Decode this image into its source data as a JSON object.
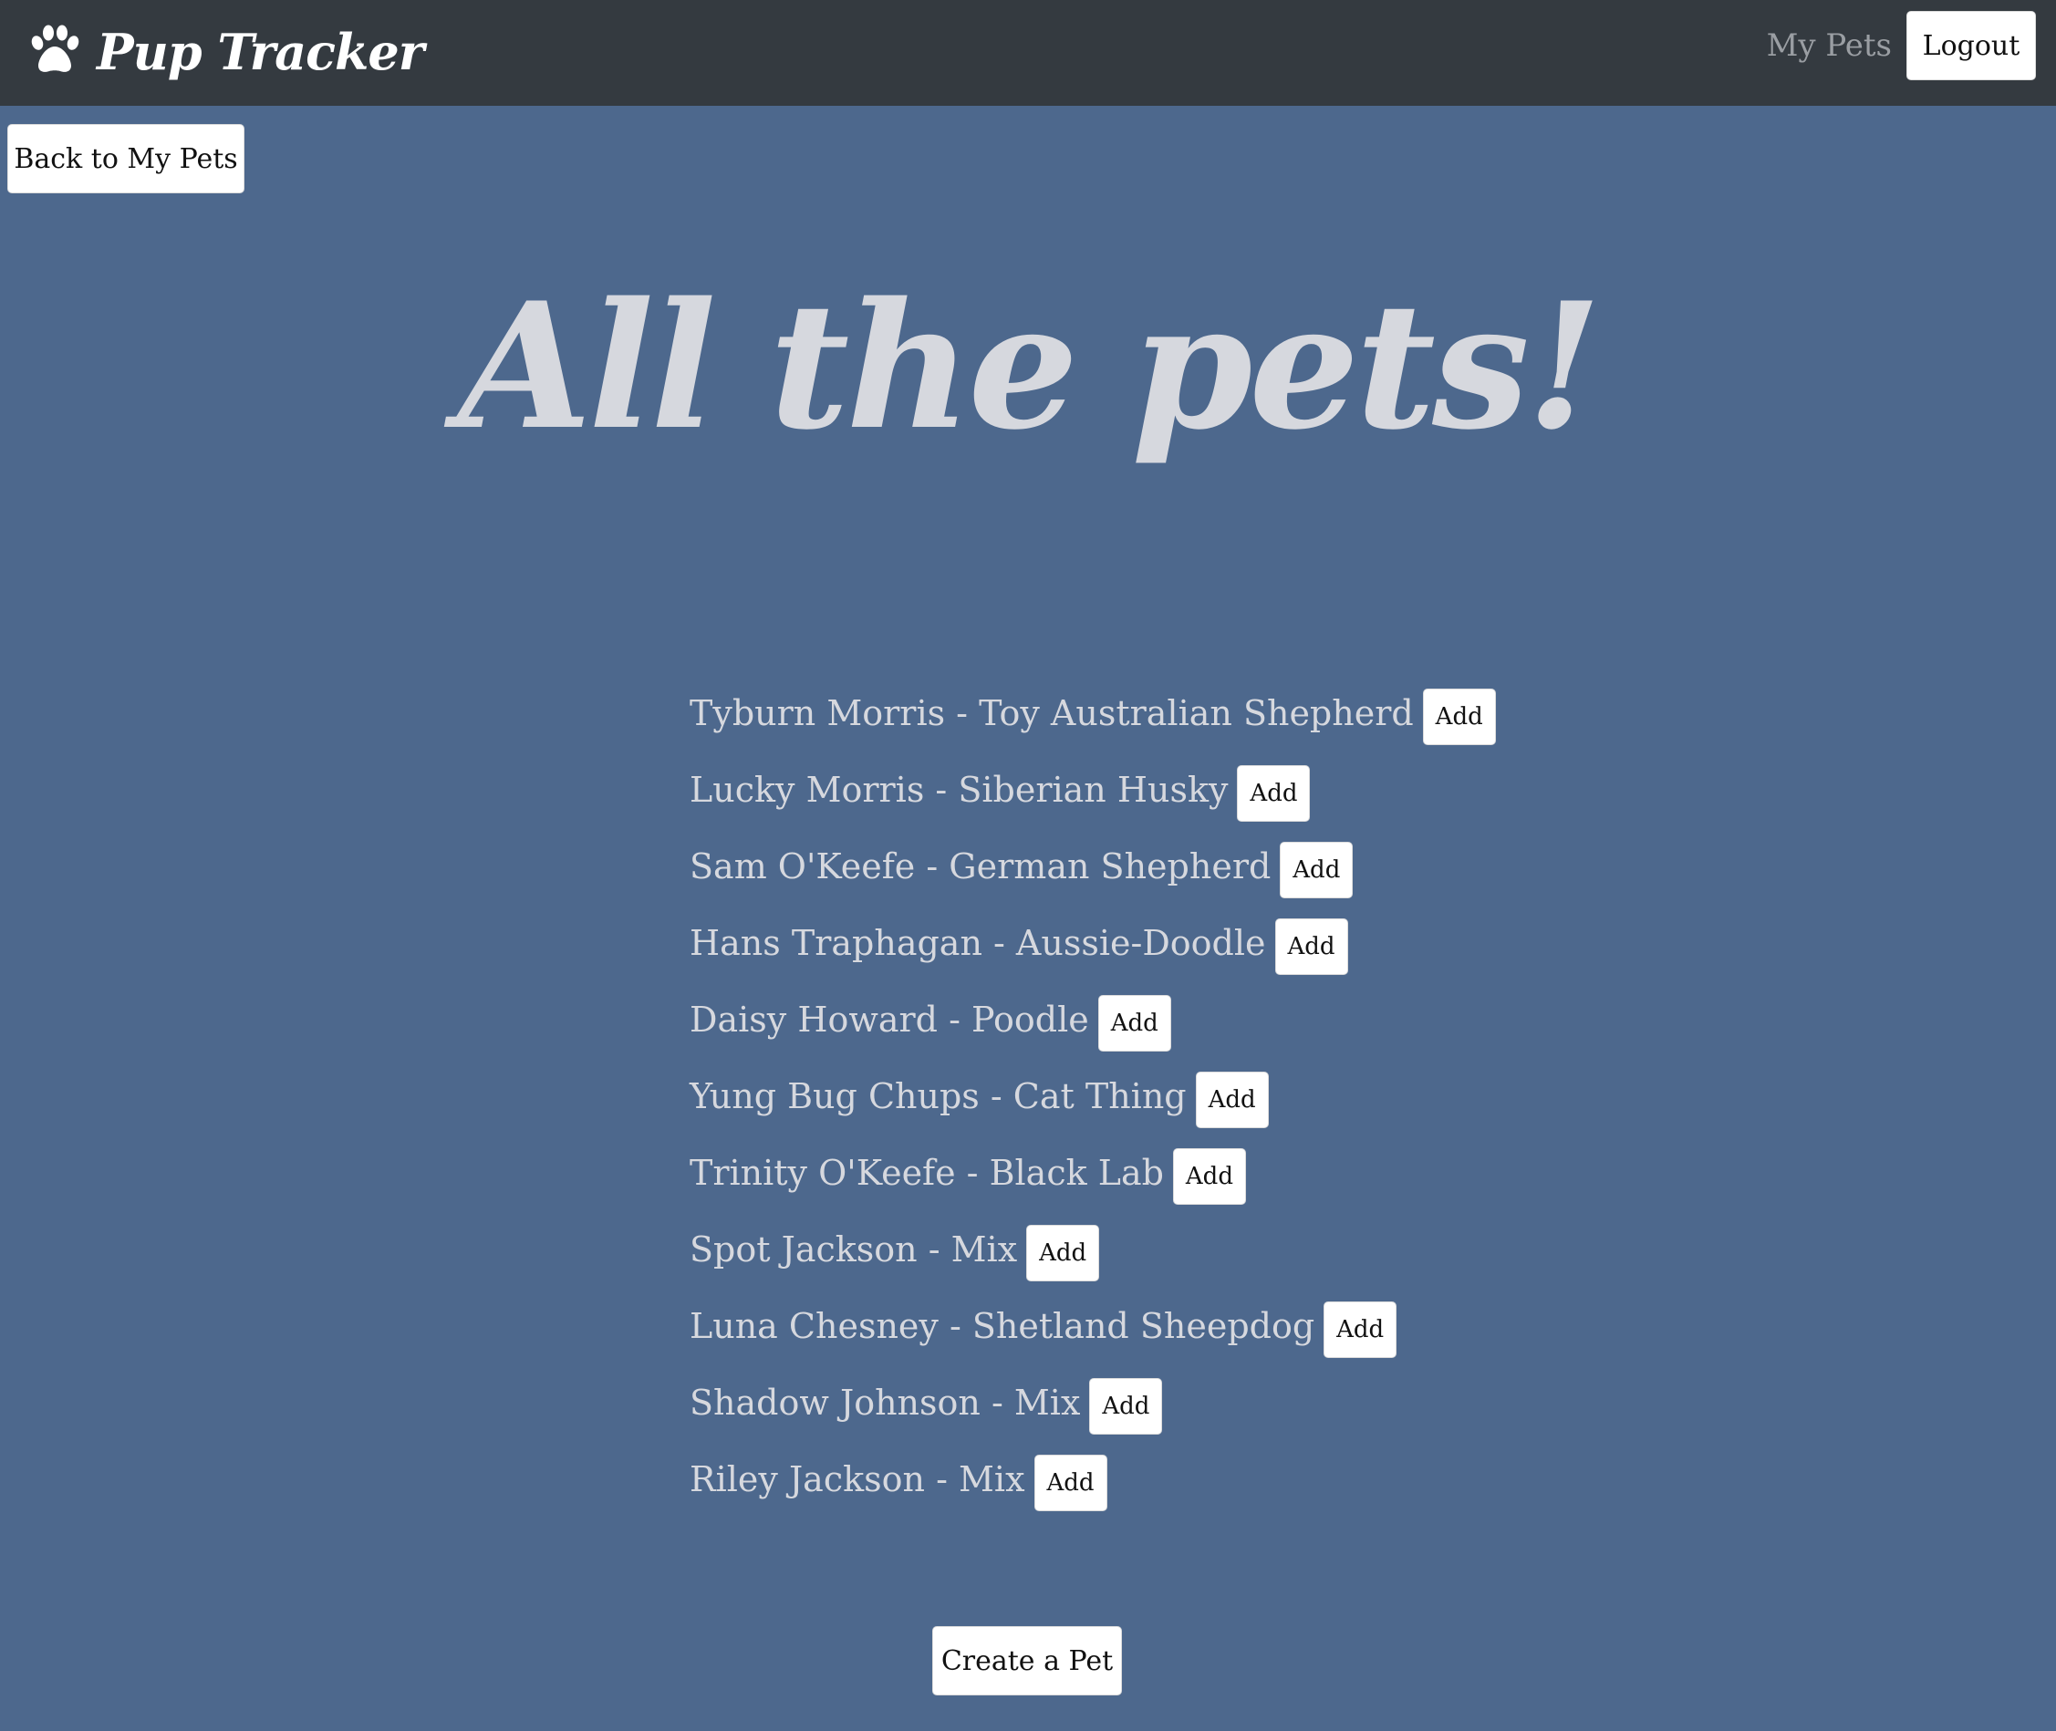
{
  "navbar": {
    "brand_icon": "paw-icon",
    "brand_text": "Pup Tracker",
    "my_pets_link": "My Pets",
    "logout_label": "Logout"
  },
  "back_button": "Back to My Pets",
  "page_title": "All the pets!",
  "pets": [
    {
      "label": "Tyburn Morris - Toy Australian Shepherd",
      "action": "Add"
    },
    {
      "label": "Lucky Morris - Siberian Husky",
      "action": "Add"
    },
    {
      "label": "Sam O'Keefe - German Shepherd",
      "action": "Add"
    },
    {
      "label": "Hans Traphagan - Aussie-Doodle",
      "action": "Add"
    },
    {
      "label": "Daisy Howard - Poodle",
      "action": "Add"
    },
    {
      "label": "Yung Bug Chups - Cat Thing",
      "action": "Add"
    },
    {
      "label": "Trinity O'Keefe - Black Lab",
      "action": "Add"
    },
    {
      "label": "Spot Jackson - Mix",
      "action": "Add"
    },
    {
      "label": "Luna Chesney - Shetland Sheepdog",
      "action": "Add"
    },
    {
      "label": "Shadow Johnson - Mix",
      "action": "Add"
    },
    {
      "label": "Riley Jackson - Mix",
      "action": "Add"
    }
  ],
  "create_button": "Create a Pet",
  "colors": {
    "background": "#4d688d",
    "navbar": "#343a40",
    "text_light": "#d6d8de",
    "nav_link": "#9a9ea3",
    "button_bg": "#ffffff"
  }
}
